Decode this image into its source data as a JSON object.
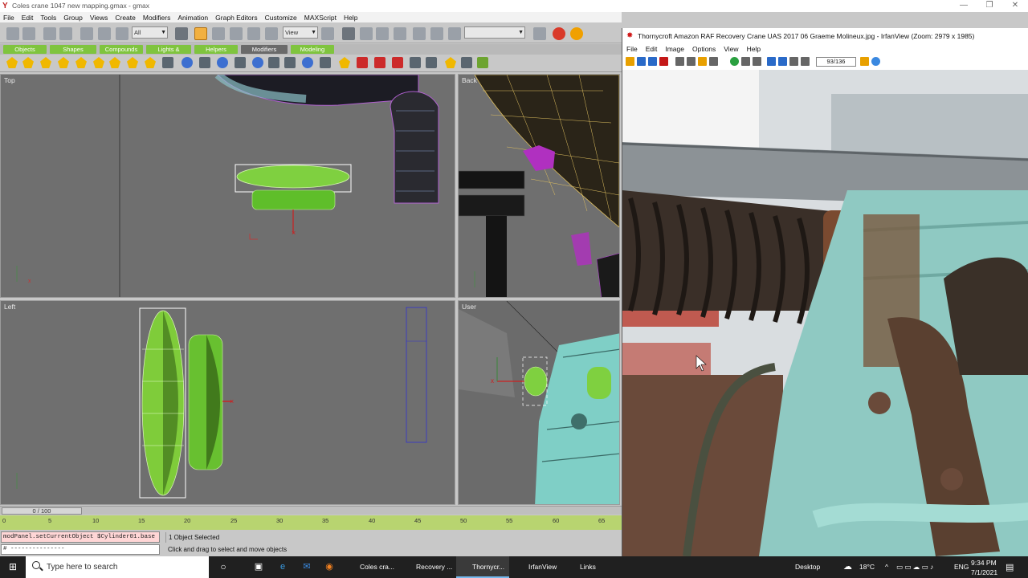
{
  "gmax": {
    "title": "Coles crane 1047 new mapping.gmax - gmax",
    "menu": [
      "File",
      "Edit",
      "Tools",
      "Group",
      "Views",
      "Create",
      "Modifiers",
      "Animation",
      "Graph Editors",
      "Customize",
      "MAXScript",
      "Help"
    ],
    "toolbar": {
      "filter_value": "All",
      "view_value": "View"
    },
    "tabs": [
      "Objects",
      "Shapes",
      "Compounds",
      "Lights & Cameras",
      "Helpers",
      "Modifiers",
      "Modeling"
    ],
    "viewports": {
      "top": "Top",
      "back": "Back",
      "left": "Left",
      "user": "User"
    },
    "time_slider": "0 / 100",
    "trackbar_ticks": [
      "0",
      "5",
      "10",
      "15",
      "20",
      "25",
      "30",
      "35",
      "40",
      "45",
      "50",
      "55",
      "60",
      "65"
    ],
    "listener_cmd": "modPanel.setCurrentObject $Cylinder01.base",
    "listener_out": "# ---------------",
    "status_selected": "1 Object Selected",
    "status_prompt": "Click and drag to select and move objects"
  },
  "irfan": {
    "title": "Thornycroft Amazon RAF Recovery Crane UAS 2017 06 Graeme Molineux.jpg - IrfanView (Zoom: 2979 x 1985)",
    "menu": [
      "File",
      "Edit",
      "Image",
      "Options",
      "View",
      "Help"
    ],
    "counter": "93/136"
  },
  "taskbar": {
    "search_placeholder": "Type here to search",
    "items": [
      "Coles cra...",
      "Recovery ...",
      "Thornycr...",
      "IrfanView"
    ],
    "links": "Links",
    "desktop": "Desktop",
    "temperature": "18°C",
    "language": "ENG",
    "time": "9:34 PM",
    "date": "7/1/2021"
  },
  "colors": {
    "accent_green": "#7fc43e",
    "viewport_bg": "#6f6f6f",
    "taskbar": "#202020",
    "engine_teal": "#8fc9c2"
  }
}
